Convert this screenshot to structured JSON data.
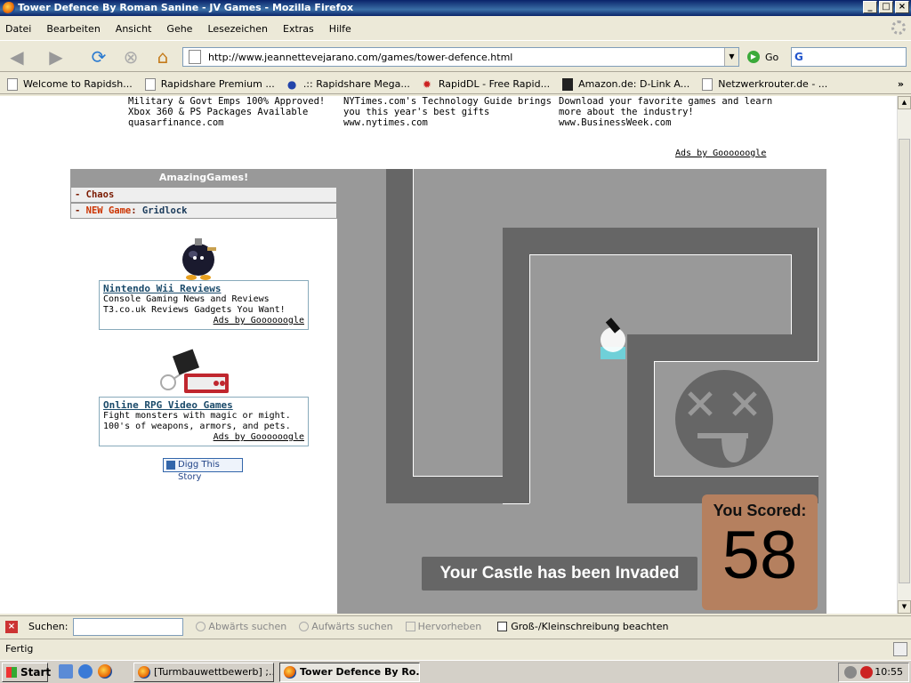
{
  "window": {
    "title": "Tower Defence By Roman Sanine - JV Games - Mozilla Firefox",
    "buttons": [
      "_",
      "□",
      "×"
    ]
  },
  "menu": [
    "Datei",
    "Bearbeiten",
    "Ansicht",
    "Gehe",
    "Lesezeichen",
    "Extras",
    "Hilfe"
  ],
  "nav": {
    "url": "http://www.jeannettevejarano.com/games/tower-defence.html",
    "go_label": "Go"
  },
  "bookmarks": [
    "Welcome to Rapidsh...",
    "Rapidshare Premium ...",
    ".:: Rapidshare Mega...",
    "RapidDL - Free Rapid...",
    "Amazon.de: D-Link A...",
    "Netzwerkrouter.de - ..."
  ],
  "top_ads": [
    {
      "line1": "Military & Govt Emps 100% Approved!",
      "line2": "Xbox 360 & PS Packages Available",
      "line3": "quasarfinance.com"
    },
    {
      "line1": "NYTimes.com's Technology Guide brings",
      "line2": "you this year's best gifts",
      "line3": "www.nytimes.com"
    },
    {
      "line1": "Download your favorite games and learn",
      "line2": "more about the industry!",
      "line3": "www.BusinessWeek.com"
    }
  ],
  "ads_by": "Ads by Goooooogle",
  "sidebar": {
    "header": "AmazingGames!",
    "item1": "Chaos",
    "item2_prefix": "NEW Game",
    "item2_name": "Gridlock",
    "ad1": {
      "title": "Nintendo Wii Reviews",
      "line1": "Console Gaming News and Reviews",
      "line2": "T3.co.uk Reviews Gadgets You Want!"
    },
    "ad2": {
      "title": "Online RPG Video Games",
      "line1": "Fight monsters with magic or might.",
      "line2": "100's of weapons, armors, and pets."
    },
    "digg": "Digg This Story"
  },
  "game": {
    "invaded_msg": "Your Castle has been Invaded",
    "score_label": "You Scored:",
    "score_value": "58"
  },
  "findbar": {
    "label": "Suchen:",
    "down": "Abwärts suchen",
    "up": "Aufwärts suchen",
    "highlight": "Hervorheben",
    "case": "Groß-/Kleinschreibung beachten"
  },
  "status": "Fertig",
  "taskbar": {
    "start": "Start",
    "tasks": [
      "[Turmbauwettbewerb] ;...",
      "Tower Defence By Ro..."
    ],
    "clock": "10:55"
  }
}
